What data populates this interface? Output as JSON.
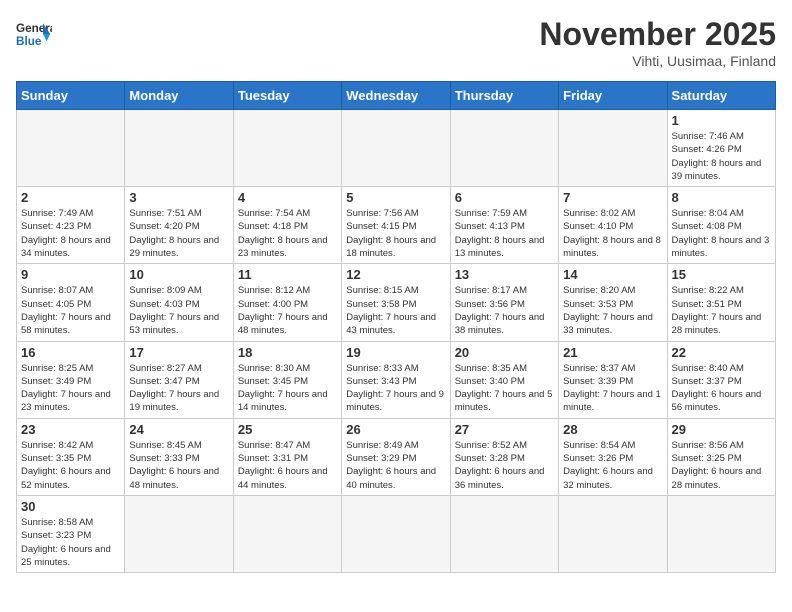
{
  "header": {
    "logo": {
      "general": "General",
      "blue": "Blue"
    },
    "title": "November 2025",
    "subtitle": "Vihti, Uusimaa, Finland"
  },
  "weekdays": [
    "Sunday",
    "Monday",
    "Tuesday",
    "Wednesday",
    "Thursday",
    "Friday",
    "Saturday"
  ],
  "days": {
    "1": {
      "sunrise": "7:46 AM",
      "sunset": "4:26 PM",
      "daylight": "8 hours and 39 minutes."
    },
    "2": {
      "sunrise": "7:49 AM",
      "sunset": "4:23 PM",
      "daylight": "8 hours and 34 minutes."
    },
    "3": {
      "sunrise": "7:51 AM",
      "sunset": "4:20 PM",
      "daylight": "8 hours and 29 minutes."
    },
    "4": {
      "sunrise": "7:54 AM",
      "sunset": "4:18 PM",
      "daylight": "8 hours and 23 minutes."
    },
    "5": {
      "sunrise": "7:56 AM",
      "sunset": "4:15 PM",
      "daylight": "8 hours and 18 minutes."
    },
    "6": {
      "sunrise": "7:59 AM",
      "sunset": "4:13 PM",
      "daylight": "8 hours and 13 minutes."
    },
    "7": {
      "sunrise": "8:02 AM",
      "sunset": "4:10 PM",
      "daylight": "8 hours and 8 minutes."
    },
    "8": {
      "sunrise": "8:04 AM",
      "sunset": "4:08 PM",
      "daylight": "8 hours and 3 minutes."
    },
    "9": {
      "sunrise": "8:07 AM",
      "sunset": "4:05 PM",
      "daylight": "7 hours and 58 minutes."
    },
    "10": {
      "sunrise": "8:09 AM",
      "sunset": "4:03 PM",
      "daylight": "7 hours and 53 minutes."
    },
    "11": {
      "sunrise": "8:12 AM",
      "sunset": "4:00 PM",
      "daylight": "7 hours and 48 minutes."
    },
    "12": {
      "sunrise": "8:15 AM",
      "sunset": "3:58 PM",
      "daylight": "7 hours and 43 minutes."
    },
    "13": {
      "sunrise": "8:17 AM",
      "sunset": "3:56 PM",
      "daylight": "7 hours and 38 minutes."
    },
    "14": {
      "sunrise": "8:20 AM",
      "sunset": "3:53 PM",
      "daylight": "7 hours and 33 minutes."
    },
    "15": {
      "sunrise": "8:22 AM",
      "sunset": "3:51 PM",
      "daylight": "7 hours and 28 minutes."
    },
    "16": {
      "sunrise": "8:25 AM",
      "sunset": "3:49 PM",
      "daylight": "7 hours and 23 minutes."
    },
    "17": {
      "sunrise": "8:27 AM",
      "sunset": "3:47 PM",
      "daylight": "7 hours and 19 minutes."
    },
    "18": {
      "sunrise": "8:30 AM",
      "sunset": "3:45 PM",
      "daylight": "7 hours and 14 minutes."
    },
    "19": {
      "sunrise": "8:33 AM",
      "sunset": "3:43 PM",
      "daylight": "7 hours and 9 minutes."
    },
    "20": {
      "sunrise": "8:35 AM",
      "sunset": "3:40 PM",
      "daylight": "7 hours and 5 minutes."
    },
    "21": {
      "sunrise": "8:37 AM",
      "sunset": "3:39 PM",
      "daylight": "7 hours and 1 minute."
    },
    "22": {
      "sunrise": "8:40 AM",
      "sunset": "3:37 PM",
      "daylight": "6 hours and 56 minutes."
    },
    "23": {
      "sunrise": "8:42 AM",
      "sunset": "3:35 PM",
      "daylight": "6 hours and 52 minutes."
    },
    "24": {
      "sunrise": "8:45 AM",
      "sunset": "3:33 PM",
      "daylight": "6 hours and 48 minutes."
    },
    "25": {
      "sunrise": "8:47 AM",
      "sunset": "3:31 PM",
      "daylight": "6 hours and 44 minutes."
    },
    "26": {
      "sunrise": "8:49 AM",
      "sunset": "3:29 PM",
      "daylight": "6 hours and 40 minutes."
    },
    "27": {
      "sunrise": "8:52 AM",
      "sunset": "3:28 PM",
      "daylight": "6 hours and 36 minutes."
    },
    "28": {
      "sunrise": "8:54 AM",
      "sunset": "3:26 PM",
      "daylight": "6 hours and 32 minutes."
    },
    "29": {
      "sunrise": "8:56 AM",
      "sunset": "3:25 PM",
      "daylight": "6 hours and 28 minutes."
    },
    "30": {
      "sunrise": "8:58 AM",
      "sunset": "3:23 PM",
      "daylight": "6 hours and 25 minutes."
    }
  },
  "labels": {
    "sunrise": "Sunrise:",
    "sunset": "Sunset:",
    "daylight": "Daylight:"
  }
}
